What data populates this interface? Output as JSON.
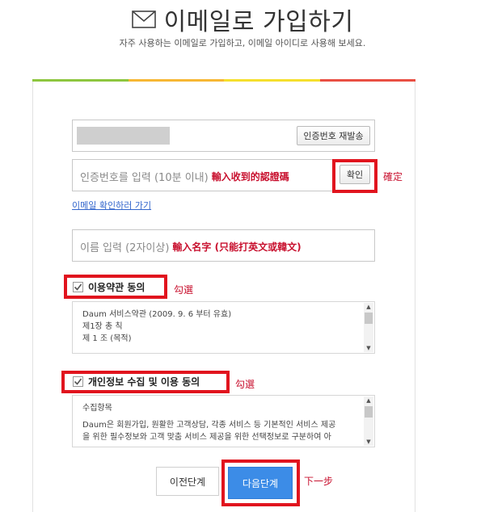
{
  "header": {
    "title": "이메일로 가입하기",
    "subtitle": "자주 사용하는 이메일로 가입하고, 이메일 아이디로 사용해 보세요."
  },
  "colors": {
    "stripe": [
      "#8dc63f",
      "#f7b733",
      "#f5df2d",
      "#e94f43"
    ],
    "accent": "#3c8ce7",
    "annotation_red": "#e1141e"
  },
  "verification": {
    "resend_label": "인증번호 재발송",
    "code_placeholder": "인증번호를 입력 (10분 이내)",
    "code_note": "輸入收到的認證碼",
    "confirm_label": "확인",
    "confirm_note": "確定",
    "check_email_link": "이메일 확인하러 가기"
  },
  "name": {
    "placeholder": "이름 입력 (2자이상)",
    "note": "輸入名字 (只能打英文或韓文)"
  },
  "terms": {
    "label": "이용약관 동의",
    "note": "勾選",
    "lines": [
      "Daum 서비스약관 (2009. 9. 6 부터 유효)",
      "제1장 총 칙",
      "제 1 조 (목적)"
    ]
  },
  "privacy": {
    "label": "개인정보 수집 및 이용 동의",
    "note": "勾選",
    "lines": [
      "수집항목",
      "",
      "Daum은 회원가입, 원활한 고객상담, 각종 서비스 등 기본적인 서비스 제공",
      "을 위한 필수정보와 고객 맞춤 서비스 제공을 위한 선택정보로 구분하여 아"
    ]
  },
  "footer": {
    "prev_label": "이전단계",
    "next_label": "다음단계",
    "next_note": "下一步"
  }
}
